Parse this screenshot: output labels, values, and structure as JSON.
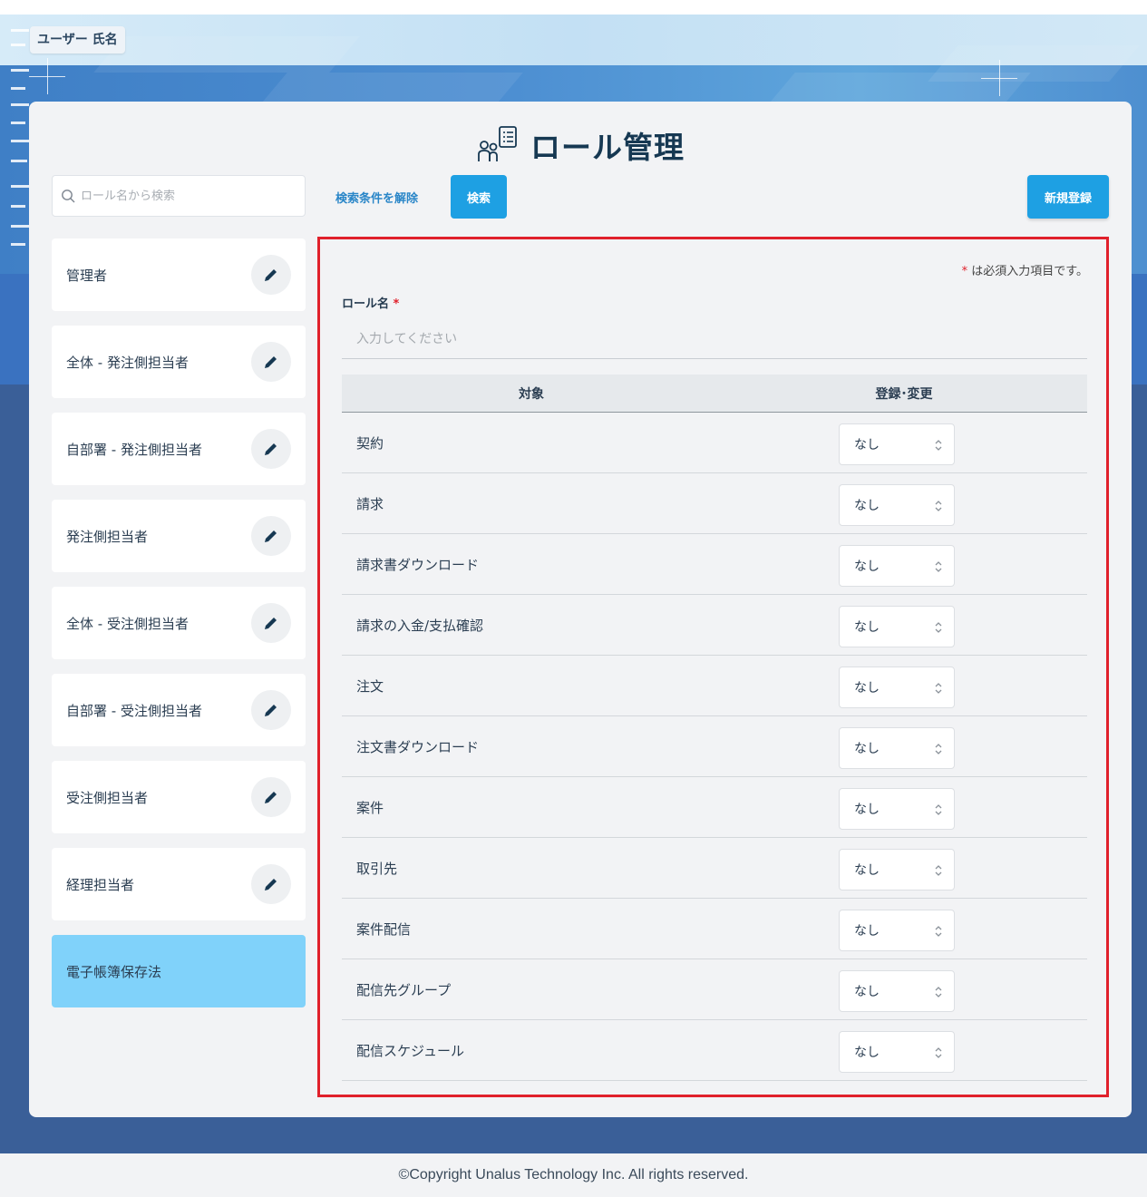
{
  "header": {
    "user_name": "ユーザー 氏名"
  },
  "page": {
    "title": "ロール管理"
  },
  "search": {
    "placeholder": "ロール名から検索",
    "clear_label": "検索条件を解除",
    "search_label": "検索",
    "new_label": "新規登録"
  },
  "roles": [
    {
      "label": "管理者"
    },
    {
      "label": "全体 - 発注側担当者"
    },
    {
      "label": "自部署 - 発注側担当者"
    },
    {
      "label": "発注側担当者"
    },
    {
      "label": "全体 - 受注側担当者"
    },
    {
      "label": "自部署 - 受注側担当者"
    },
    {
      "label": "受注側担当者"
    },
    {
      "label": "経理担当者"
    },
    {
      "label": "電子帳簿保存法",
      "active": true
    }
  ],
  "form": {
    "required_star": "*",
    "required_note": " は必須入力項目です。",
    "role_name_label": "ロール名",
    "role_name_placeholder": "入力してください",
    "col_target": "対象",
    "col_register": "登録･変更",
    "rows": [
      {
        "target": "契約",
        "value": "なし"
      },
      {
        "target": "請求",
        "value": "なし"
      },
      {
        "target": "請求書ダウンロード",
        "value": "なし"
      },
      {
        "target": "請求の入金/支払確認",
        "value": "なし"
      },
      {
        "target": "注文",
        "value": "なし"
      },
      {
        "target": "注文書ダウンロード",
        "value": "なし"
      },
      {
        "target": "案件",
        "value": "なし"
      },
      {
        "target": "取引先",
        "value": "なし"
      },
      {
        "target": "案件配信",
        "value": "なし"
      },
      {
        "target": "配信先グループ",
        "value": "なし"
      },
      {
        "target": "配信スケジュール",
        "value": "なし"
      }
    ]
  },
  "footer": {
    "copyright": "©Copyright Unalus Technology Inc. All rights reserved."
  },
  "colors": {
    "accent": "#1ea0e3",
    "active_role": "#80d2fa",
    "highlight_border": "#e0202b",
    "title": "#163852"
  }
}
